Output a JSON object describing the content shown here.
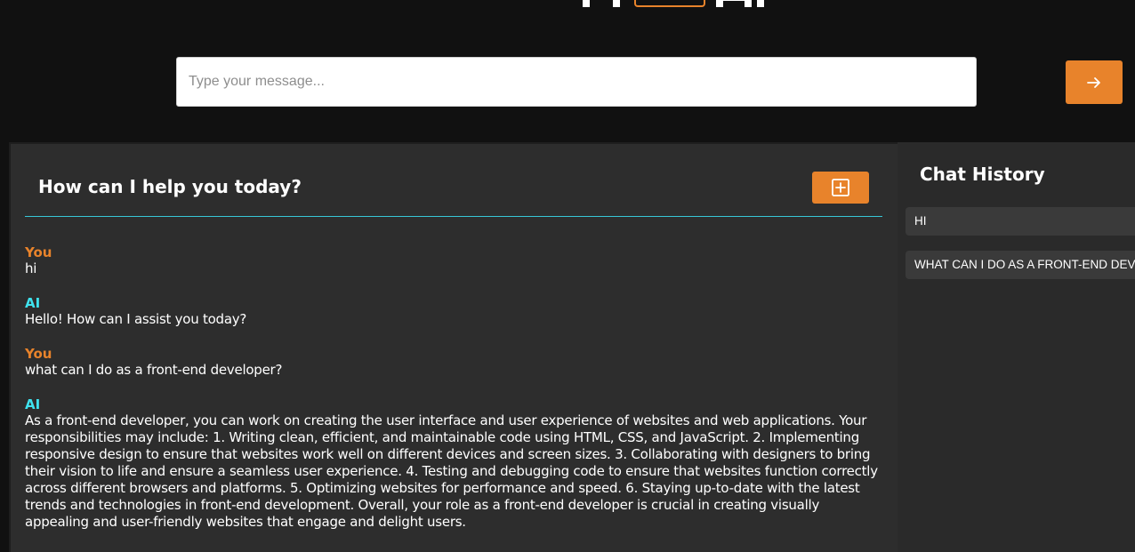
{
  "colors": {
    "accent": "#e8832b",
    "ai_label": "#3fe2ee",
    "divider": "#37c6d6",
    "background": "#111111",
    "panel": "#2d2d2d"
  },
  "input": {
    "placeholder": "Type your message...",
    "value": ""
  },
  "send_button": {
    "icon": "arrow-right-icon"
  },
  "chat": {
    "title": "How can I help you today?",
    "new_chat_icon": "plus-square-icon",
    "messages": [
      {
        "sender": "You",
        "text": "hi"
      },
      {
        "sender": "AI",
        "text": "Hello! How can I assist you today?"
      },
      {
        "sender": "You",
        "text": "what can I do as a front-end developer?"
      },
      {
        "sender": "AI",
        "text": "As a front-end developer, you can work on creating the user interface and user experience of websites and web applications. Your responsibilities may include: 1. Writing clean, efficient, and maintainable code using HTML, CSS, and JavaScript. 2. Implementing responsive design to ensure that websites work well on different devices and screen sizes. 3. Collaborating with designers to bring their vision to life and ensure a seamless user experience. 4. Testing and debugging code to ensure that websites function correctly across different browsers and platforms. 5. Optimizing websites for performance and speed. 6. Staying up-to-date with the latest trends and technologies in front-end development. Overall, your role as a front-end developer is crucial in creating visually appealing and user-friendly websites that engage and delight users."
      }
    ]
  },
  "history": {
    "title": "Chat History",
    "items": [
      {
        "label": "HI"
      },
      {
        "label": "WHAT CAN I DO AS A FRONT-END DEVELOPER?"
      }
    ]
  }
}
